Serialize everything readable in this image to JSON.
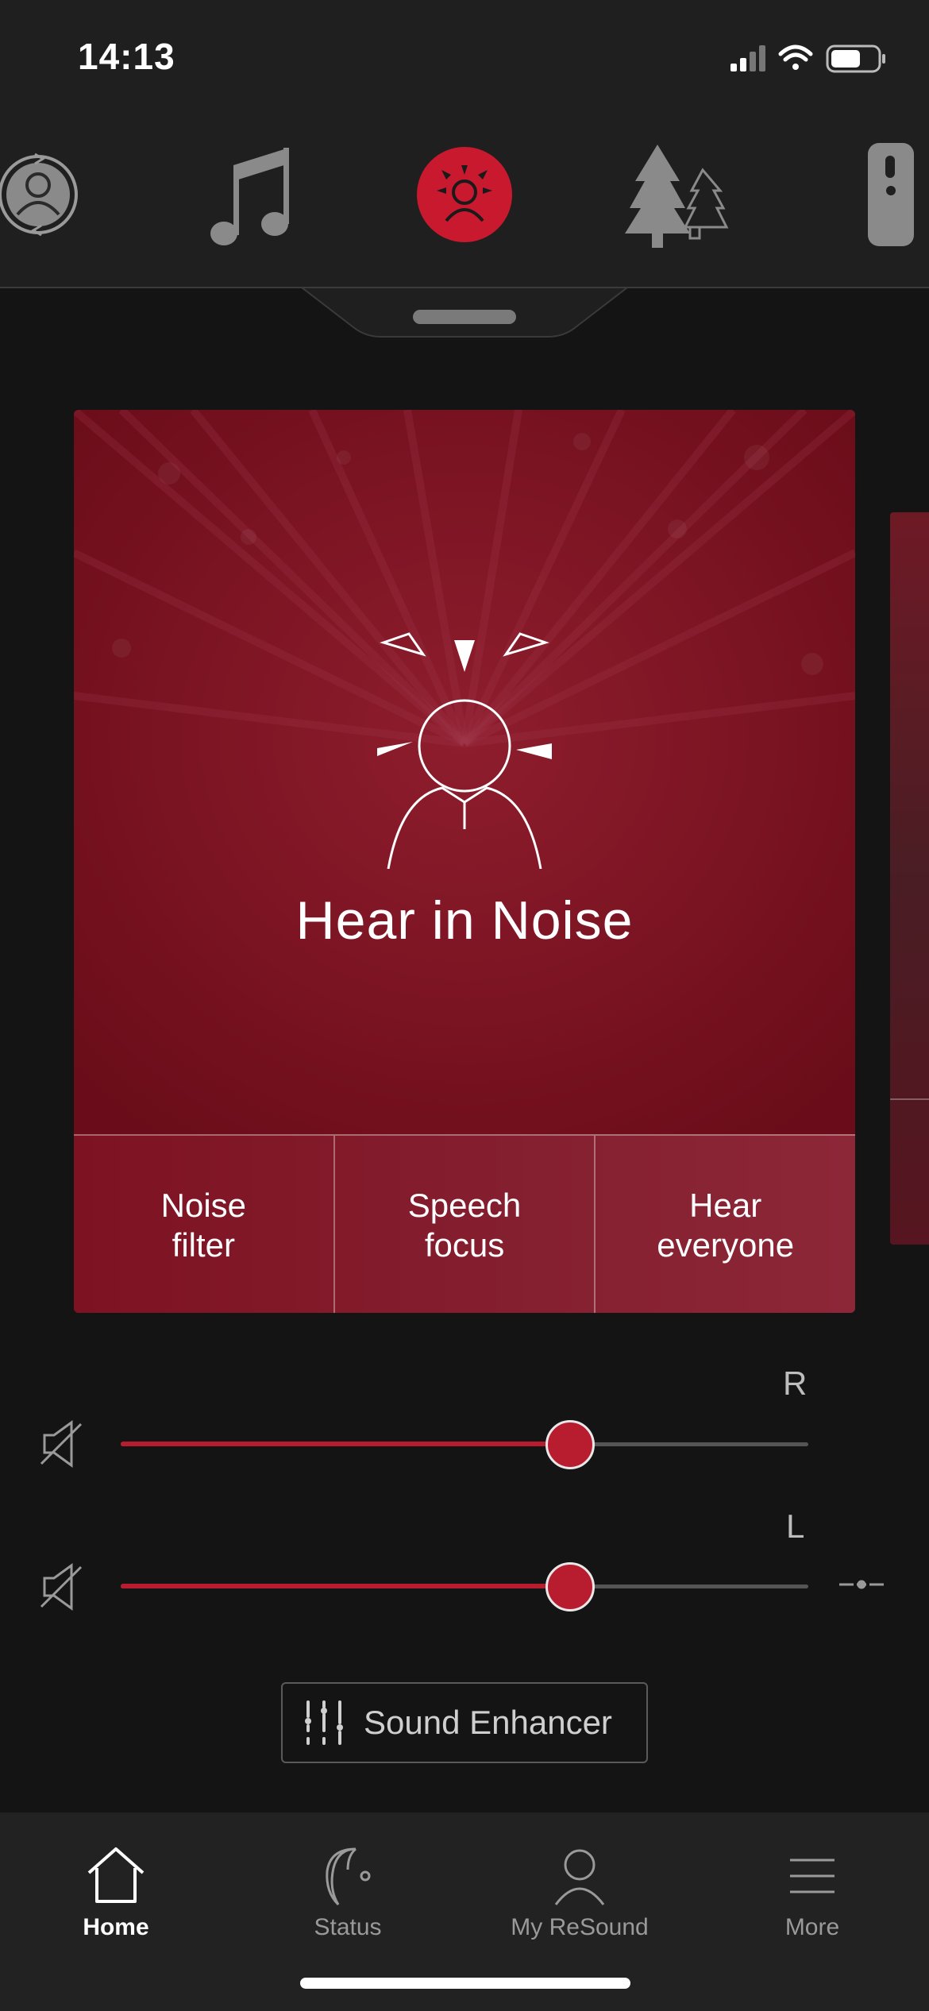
{
  "status_bar": {
    "time": "14:13"
  },
  "programs": [
    {
      "name": "person-cycle-icon",
      "active": false
    },
    {
      "name": "music-note-icon",
      "active": false
    },
    {
      "name": "hear-in-noise-icon",
      "active": true
    },
    {
      "name": "outdoor-trees-icon",
      "active": false
    },
    {
      "name": "remote-mic-icon",
      "active": false
    }
  ],
  "card": {
    "title": "Hear in Noise",
    "options": [
      {
        "line1": "Noise",
        "line2": "filter"
      },
      {
        "line1": "Speech",
        "line2": "focus"
      },
      {
        "line1": "Hear",
        "line2": "everyone"
      }
    ]
  },
  "volume": {
    "right": {
      "label": "R",
      "level": 0.654
    },
    "left": {
      "label": "L",
      "level": 0.654
    }
  },
  "sound_enhancer": {
    "label": "Sound Enhancer"
  },
  "tabbar": {
    "tabs": [
      {
        "label": "Home",
        "active": true
      },
      {
        "label": "Status",
        "active": false
      },
      {
        "label": "My ReSound",
        "active": false
      },
      {
        "label": "More",
        "active": false
      }
    ]
  },
  "colors": {
    "accent": "#b71c2f",
    "card": "#7a1020",
    "background": "#141414"
  }
}
